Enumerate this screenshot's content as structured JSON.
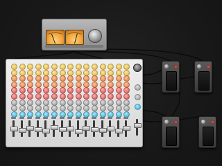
{
  "scene": {
    "name": "mixing-desk",
    "accent": "#f0a23a"
  },
  "vu_unit": {
    "label": "",
    "meters": [
      {
        "needle": -20
      },
      {
        "needle": 15
      }
    ]
  },
  "mixer": {
    "channel_count": 15,
    "channel_labels": [
      "",
      "",
      "",
      "",
      "",
      "",
      "",
      "",
      "",
      "",
      "",
      "",
      "",
      "",
      ""
    ],
    "knob_rows": [
      "yellow",
      "yellow",
      "orange",
      "orange",
      "red",
      "red",
      "gray",
      "gray",
      "blue"
    ],
    "fader_levels": [
      0.55,
      0.45,
      0.6,
      0.5,
      0.4,
      0.65,
      0.5,
      0.55,
      0.35,
      0.6,
      0.5,
      0.45,
      0.55,
      0.4,
      0.6
    ]
  },
  "pedals": [
    {
      "name": "pedal-1",
      "label": ""
    },
    {
      "name": "pedal-2",
      "label": ""
    },
    {
      "name": "pedal-3",
      "label": ""
    },
    {
      "name": "pedal-4",
      "label": ""
    }
  ]
}
